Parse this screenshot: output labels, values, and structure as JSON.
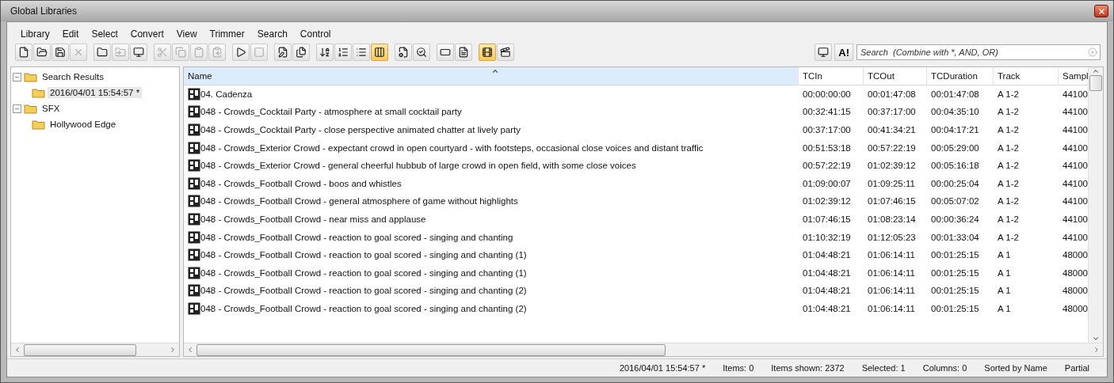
{
  "window": {
    "title": "Global Libraries"
  },
  "menu": [
    "Library",
    "Edit",
    "Select",
    "Convert",
    "View",
    "Trimmer",
    "Search",
    "Control"
  ],
  "toolbar": [
    [
      {
        "disabled": false,
        "on": false
      },
      {
        "disabled": false,
        "on": false
      },
      {
        "disabled": false,
        "on": false
      },
      {
        "disabled": true,
        "on": false
      }
    ],
    [
      {
        "disabled": false,
        "on": false
      },
      {
        "disabled": true,
        "on": false
      },
      {
        "disabled": false,
        "on": false
      }
    ],
    [
      {
        "disabled": true,
        "on": false
      },
      {
        "disabled": true,
        "on": false
      },
      {
        "disabled": true,
        "on": false
      },
      {
        "disabled": true,
        "on": false
      }
    ],
    [
      {
        "disabled": false,
        "on": false
      },
      {
        "disabled": true,
        "on": false
      }
    ],
    [
      {
        "disabled": false,
        "on": false
      },
      {
        "disabled": false,
        "on": false
      }
    ],
    [
      {
        "disabled": false,
        "on": false
      },
      {
        "disabled": false,
        "on": false
      },
      {
        "disabled": false,
        "on": false
      },
      {
        "disabled": false,
        "on": true
      }
    ],
    [
      {
        "disabled": false,
        "on": false
      },
      {
        "disabled": false,
        "on": false
      }
    ],
    [
      {
        "disabled": false,
        "on": false
      },
      {
        "disabled": false,
        "on": false
      }
    ],
    [
      {
        "disabled": false,
        "on": true
      },
      {
        "disabled": false,
        "on": false
      }
    ]
  ],
  "search_tools": {
    "font_button": "A!",
    "placeholder": "Search  (Combine with *, AND, OR)"
  },
  "tree": [
    {
      "label": "Search Results",
      "expanded": true,
      "selected": false,
      "children": [
        {
          "label": "2016/04/01 15:54:57 *",
          "selected": true
        }
      ]
    },
    {
      "label": "SFX",
      "expanded": true,
      "selected": false,
      "children": [
        {
          "label": "Hollywood Edge",
          "selected": false
        }
      ]
    }
  ],
  "table": {
    "columns": [
      {
        "label": "Name",
        "sorted": true
      },
      {
        "label": "TCIn",
        "sorted": false
      },
      {
        "label": "TCOut",
        "sorted": false
      },
      {
        "label": "TCDuration",
        "sorted": false
      },
      {
        "label": "Track",
        "sorted": false
      },
      {
        "label": "Sampl",
        "sorted": false
      }
    ],
    "rows": [
      [
        "04. Cadenza",
        "00:00:00:00",
        "00:01:47:08",
        "00:01:47:08",
        "A 1-2",
        "44100"
      ],
      [
        "048 - Crowds_Cocktail Party - atmosphere at small cocktail party",
        "00:32:41:15",
        "00:37:17:00",
        "00:04:35:10",
        "A 1-2",
        "44100"
      ],
      [
        "048 - Crowds_Cocktail Party - close perspective animated chatter at lively party",
        "00:37:17:00",
        "00:41:34:21",
        "00:04:17:21",
        "A 1-2",
        "44100"
      ],
      [
        "048 - Crowds_Exterior Crowd - expectant crowd in open courtyard - with footsteps, occasional close voices and distant traffic",
        "00:51:53:18",
        "00:57:22:19",
        "00:05:29:00",
        "A 1-2",
        "44100"
      ],
      [
        "048 - Crowds_Exterior Crowd - general cheerful hubbub of large crowd in open field, with some close voices",
        "00:57:22:19",
        "01:02:39:12",
        "00:05:16:18",
        "A 1-2",
        "44100"
      ],
      [
        "048 - Crowds_Football Crowd - boos and whistles",
        "01:09:00:07",
        "01:09:25:11",
        "00:00:25:04",
        "A 1-2",
        "44100"
      ],
      [
        "048 - Crowds_Football Crowd - general atmosphere of game without highlights",
        "01:02:39:12",
        "01:07:46:15",
        "00:05:07:02",
        "A 1-2",
        "44100"
      ],
      [
        "048 - Crowds_Football Crowd - near miss and applause",
        "01:07:46:15",
        "01:08:23:14",
        "00:00:36:24",
        "A 1-2",
        "44100"
      ],
      [
        "048 - Crowds_Football Crowd - reaction to goal scored - singing and chanting",
        "01:10:32:19",
        "01:12:05:23",
        "00:01:33:04",
        "A 1-2",
        "44100"
      ],
      [
        "048 - Crowds_Football Crowd - reaction to goal scored - singing and chanting (1)",
        "01:04:48:21",
        "01:06:14:11",
        "00:01:25:15",
        "A 1",
        "48000"
      ],
      [
        "048 - Crowds_Football Crowd - reaction to goal scored - singing and chanting (1)",
        "01:04:48:21",
        "01:06:14:11",
        "00:01:25:15",
        "A 1",
        "48000"
      ],
      [
        "048 - Crowds_Football Crowd - reaction to goal scored - singing and chanting (2)",
        "01:04:48:21",
        "01:06:14:11",
        "00:01:25:15",
        "A 1",
        "48000"
      ],
      [
        "048 - Crowds_Football Crowd - reaction to goal scored - singing and chanting (2)",
        "01:04:48:21",
        "01:06:14:11",
        "00:01:25:15",
        "A 1",
        "48000"
      ]
    ]
  },
  "status_bar": [
    "2016/04/01 15:54:57 *",
    "Items: 0",
    "Items shown: 2372",
    "Selected: 1",
    "Columns: 0",
    "Sorted by Name",
    "Partial"
  ]
}
